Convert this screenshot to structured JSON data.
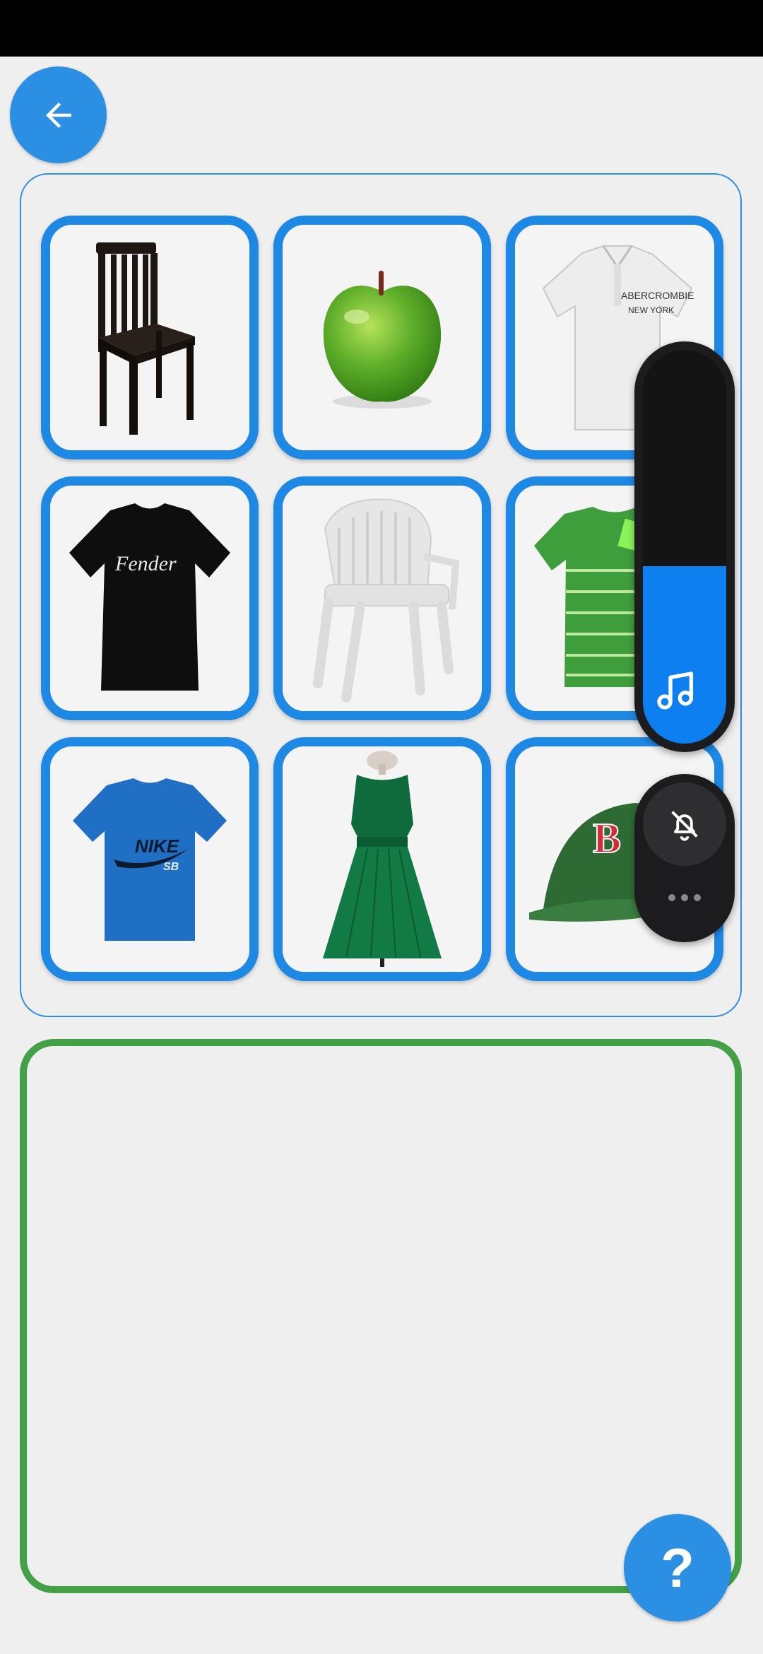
{
  "app": {
    "accent_color": "#2b8fe3",
    "card_border_color": "#1e88e5",
    "answer_border_color": "#43a047"
  },
  "header": {
    "back_icon": "arrow-left-icon"
  },
  "grid": {
    "items": [
      {
        "name": "chair-wooden-black"
      },
      {
        "name": "green-apple"
      },
      {
        "name": "white-polo-shirt"
      },
      {
        "name": "black-tshirt"
      },
      {
        "name": "white-plastic-chair"
      },
      {
        "name": "green-striped-tshirt"
      },
      {
        "name": "blue-tshirt"
      },
      {
        "name": "green-dress"
      },
      {
        "name": "green-cap"
      }
    ]
  },
  "help_button": {
    "label": "?"
  },
  "volume_overlay": {
    "level": 0.45,
    "accent_color": "#0e7ff0",
    "stream_icon": "music-note-icon",
    "ringer_icon": "bell-off-icon",
    "more_icon": "more-horizontal-icon"
  }
}
